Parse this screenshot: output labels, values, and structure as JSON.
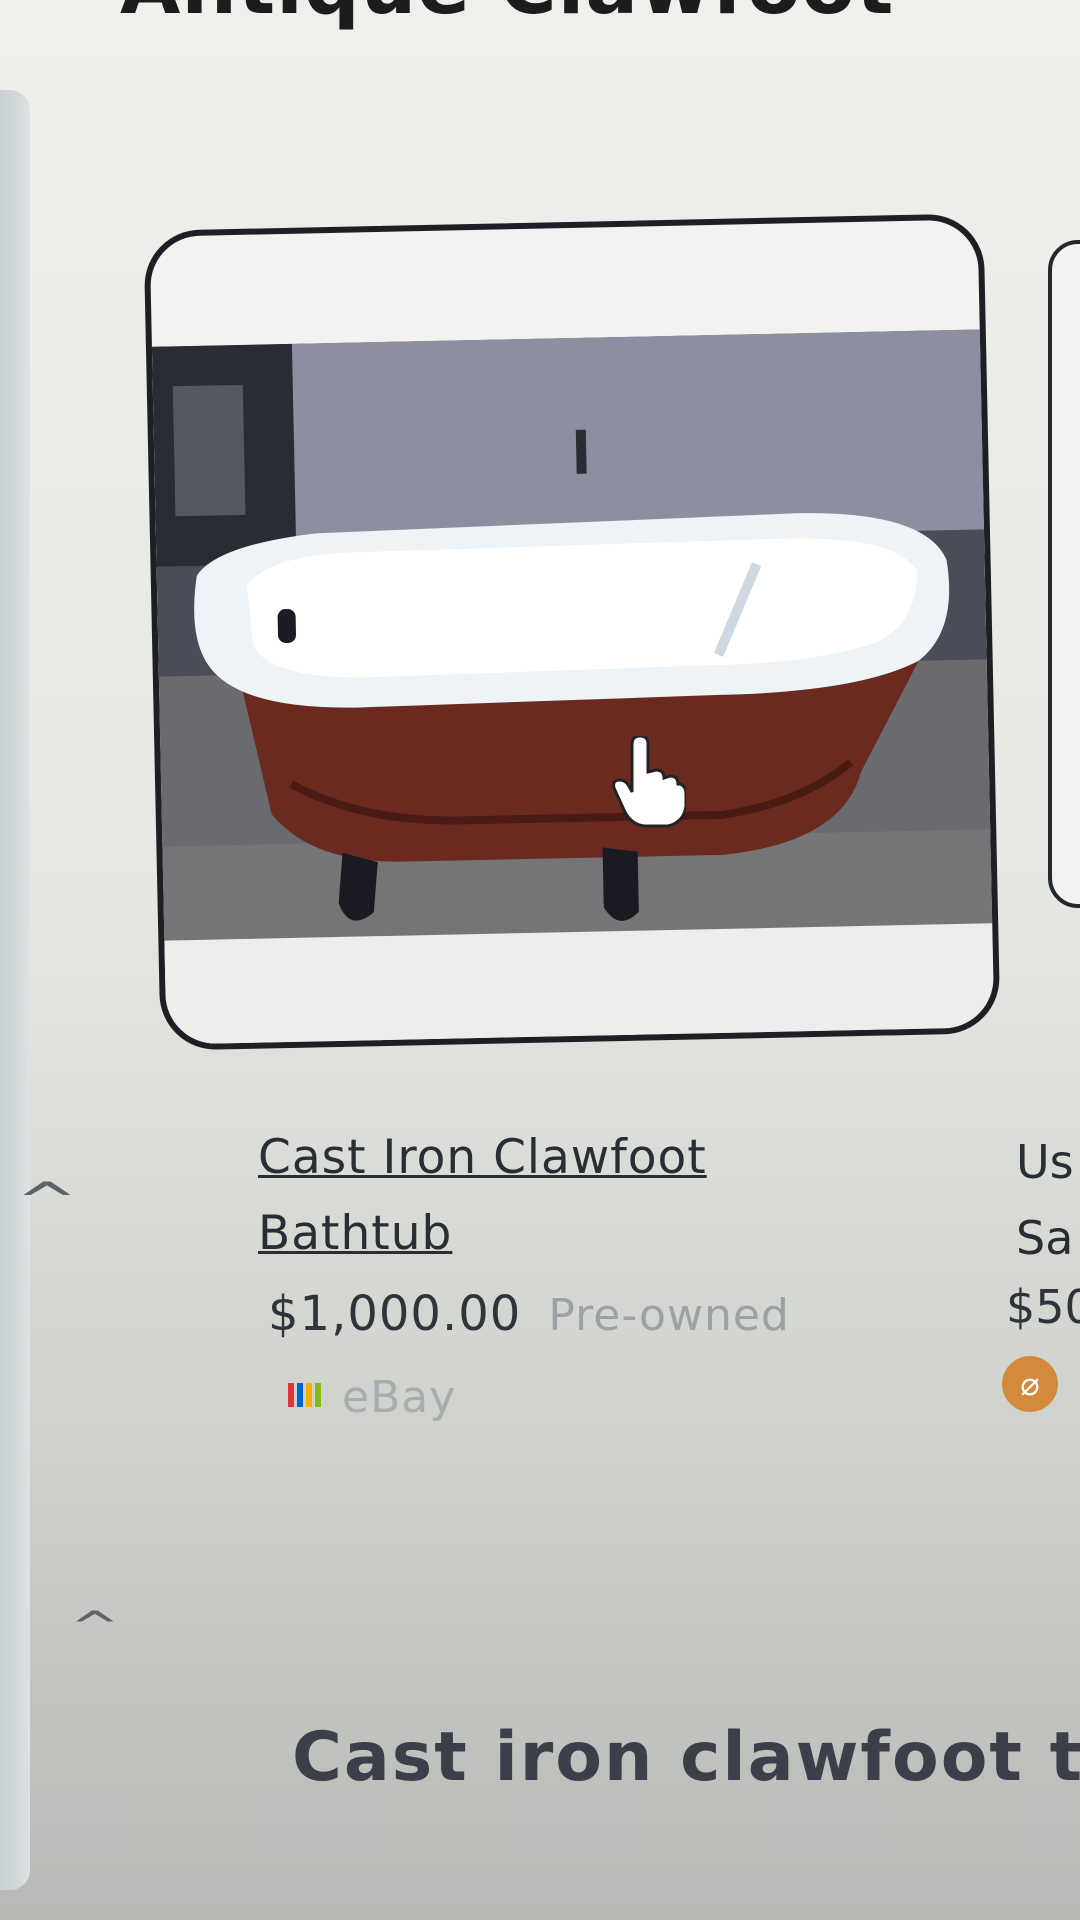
{
  "page": {
    "heading_top": "Antique Clawfoot",
    "bottom_heading": "Cast iron clawfoot tu"
  },
  "product": {
    "title": "Cast Iron Clawfoot Bathtub",
    "price": "$1,000.00",
    "condition": "Pre-owned",
    "seller": "eBay",
    "seller_icon": "ebay-logo-icon"
  },
  "next_product": {
    "title_partial": "Us Sa",
    "price_partial": "$50",
    "badge_icon": "seller-badge-icon"
  },
  "icons": {
    "collapse": "chevron-up-icon",
    "cursor": "hand-pointer-icon"
  },
  "colors": {
    "card_border": "#1d1f24",
    "price_text": "#30333a",
    "muted_text": "#9da1a3",
    "badge": "#d48a3c"
  }
}
